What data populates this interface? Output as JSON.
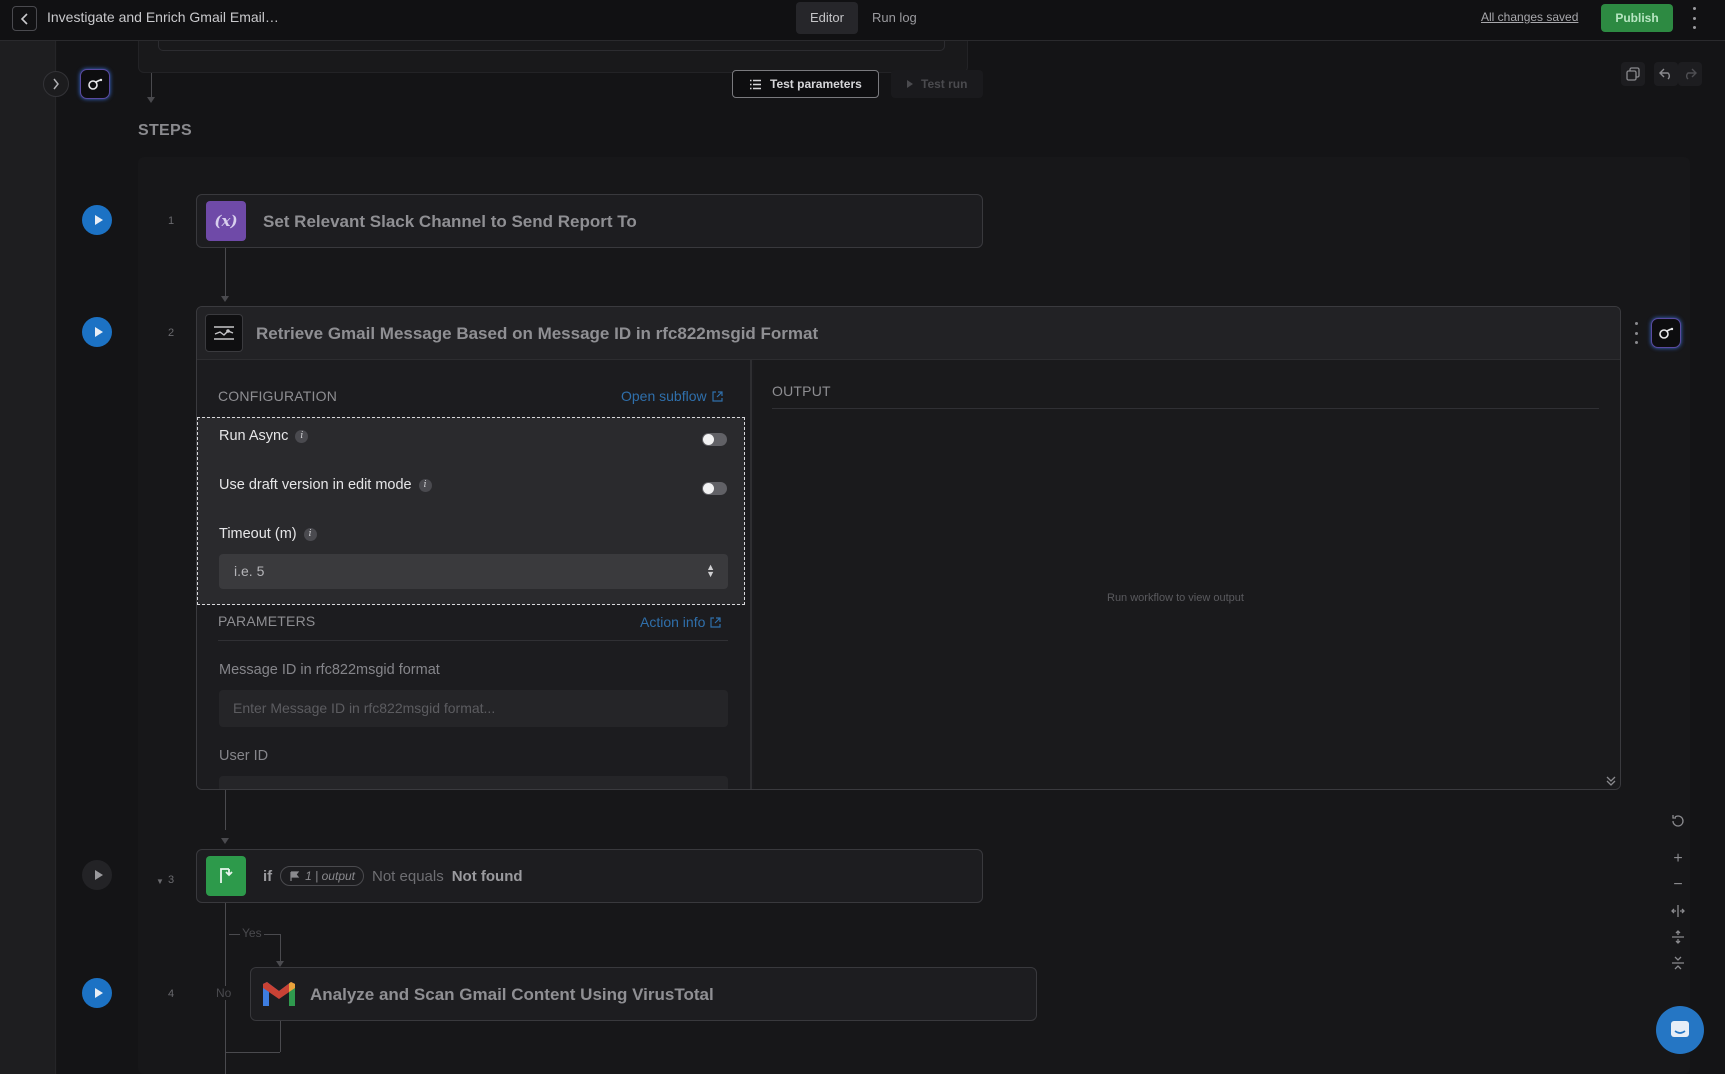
{
  "header": {
    "title": "Investigate and Enrich Gmail Email…",
    "tabs": [
      {
        "label": "Editor"
      },
      {
        "label": "Run log"
      }
    ],
    "saved_status": "All changes saved",
    "publish_label": "Publish"
  },
  "toolbar": {
    "test_parameters_label": "Test parameters",
    "test_run_label": "Test run"
  },
  "steps_label": "STEPS",
  "steps": [
    {
      "number": "1",
      "title": "Set Relevant Slack Channel to Send Report To",
      "icon": "variable-icon",
      "icon_text": "(x)"
    },
    {
      "number": "2",
      "title": "Retrieve Gmail Message Based on Message ID in rfc822msgid Format",
      "icon": "subflow-icon"
    },
    {
      "number": "3",
      "if_label": "if",
      "chip_label": "1 | output",
      "operator": "Not equals",
      "value": "Not found",
      "icon": "branch-icon"
    },
    {
      "number": "4",
      "title": "Analyze and Scan Gmail Content Using VirusTotal",
      "icon": "gmail-icon"
    }
  ],
  "branch": {
    "yes_label": "Yes",
    "no_label": "No"
  },
  "config": {
    "section_label": "CONFIGURATION",
    "open_subflow_label": "Open subflow",
    "run_async_label": "Run Async",
    "draft_label": "Use draft version in edit mode",
    "timeout_label": "Timeout (m)",
    "timeout_placeholder": "i.e. 5"
  },
  "parameters": {
    "section_label": "PARAMETERS",
    "action_info_label": "Action info",
    "message_id_label": "Message ID in rfc822msgid format",
    "message_id_placeholder": "Enter Message ID in rfc822msgid format...",
    "user_id_label": "User ID"
  },
  "output": {
    "section_label": "OUTPUT",
    "empty_message": "Run workflow to view output"
  },
  "colors": {
    "accent": "#1c72c4",
    "publish": "#2d8a42",
    "variable": "#6f4aa8",
    "branch": "#2d9a4b"
  }
}
